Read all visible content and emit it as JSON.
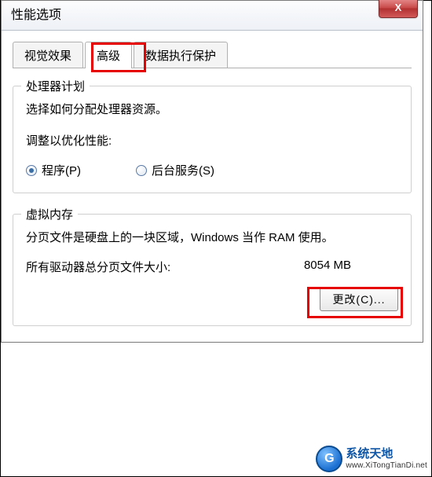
{
  "window": {
    "title": "性能选项",
    "close_label": "X"
  },
  "tabs": {
    "visualEffects": "视觉效果",
    "advanced": "高级",
    "dep": "数据执行保护"
  },
  "processor": {
    "legend": "处理器计划",
    "desc": "选择如何分配处理器资源。",
    "adjustLabel": "调整以优化性能:",
    "programs": "程序(P)",
    "background": "后台服务(S)"
  },
  "virtualMemory": {
    "legend": "虚拟内存",
    "desc": "分页文件是硬盘上的一块区域，Windows 当作 RAM 使用。",
    "totalLabel": "所有驱动器总分页文件大小:",
    "totalValue": "8054 MB",
    "changeBtn": "更改(C)..."
  },
  "watermark": {
    "title": "系统天地",
    "url": "www.XiTongTianDi.net"
  }
}
